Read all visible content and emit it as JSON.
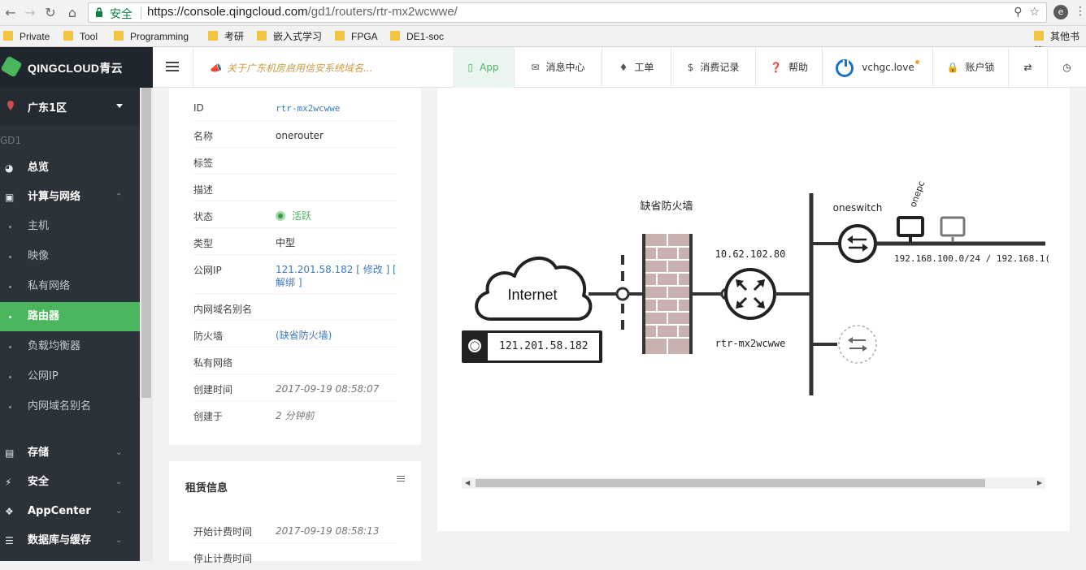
{
  "browser": {
    "secure_label": "安全",
    "url_host": "https://console.qingcloud.com",
    "url_path": "/gd1/routers/rtr-mx2wcwwe/",
    "bookmarks": [
      "Private",
      "Tool",
      "Programming",
      "考研",
      "嵌入式学习",
      "FPGA",
      "DE1-soc"
    ],
    "other_bookmarks": "其他书签"
  },
  "header": {
    "logo": "QINGCLOUD青云",
    "notice": "关于广东机房启用信安系统域名...",
    "nav": [
      {
        "icon": "phone-icon",
        "label": "App"
      },
      {
        "icon": "mail-icon",
        "label": "消息中心"
      },
      {
        "icon": "ticket-icon",
        "label": "工单"
      },
      {
        "icon": "dollar-icon",
        "label": "消费记录"
      },
      {
        "icon": "help-icon",
        "label": "帮助"
      },
      {
        "icon": "user-icon",
        "label": "vchgc.love"
      },
      {
        "icon": "lock-icon",
        "label": "账户锁"
      }
    ]
  },
  "sidebar": {
    "region": "广东1区",
    "zone": "GD1",
    "items": [
      {
        "icon": "dashboard-icon",
        "label": "总览",
        "type": "top"
      },
      {
        "icon": "monitor-icon",
        "label": "计算与网络",
        "type": "group-open"
      },
      {
        "label": "主机",
        "type": "sub"
      },
      {
        "label": "映像",
        "type": "sub"
      },
      {
        "label": "私有网络",
        "type": "sub"
      },
      {
        "label": "路由器",
        "type": "sub-active"
      },
      {
        "label": "负载均衡器",
        "type": "sub"
      },
      {
        "label": "公网IP",
        "type": "sub"
      },
      {
        "label": "内网域名别名",
        "type": "sub"
      },
      {
        "icon": "storage-icon",
        "label": "存储",
        "type": "group"
      },
      {
        "icon": "bolt-icon",
        "label": "安全",
        "type": "group"
      },
      {
        "icon": "puzzle-icon",
        "label": "AppCenter",
        "type": "group"
      },
      {
        "icon": "database-icon",
        "label": "数据库与缓存",
        "type": "group"
      }
    ]
  },
  "details": {
    "rows": [
      {
        "key": "ID",
        "value": "rtr-mx2wcwwe",
        "style": "mono"
      },
      {
        "key": "名称",
        "value": "onerouter",
        "style": "plain"
      },
      {
        "key": "标签",
        "value": "",
        "style": "plain"
      },
      {
        "key": "描述",
        "value": "",
        "style": "plain"
      },
      {
        "key": "状态",
        "value": "活跃",
        "style": "status"
      },
      {
        "key": "类型",
        "value": "中型",
        "style": "plain"
      },
      {
        "key": "公网IP",
        "value": "121.201.58.182 [ 修改 ] [ 解绑 ]",
        "style": "link"
      },
      {
        "key": "内网域名别名",
        "value": "",
        "style": "plain"
      },
      {
        "key": "防火墙",
        "value": "(缺省防火墙)",
        "style": "link"
      },
      {
        "key": "私有网络",
        "value": "",
        "style": "plain"
      },
      {
        "key": "创建时间",
        "value": "2017-09-19 08:58:07",
        "style": "ital"
      },
      {
        "key": "创建于",
        "value": "2 分钟前",
        "style": "ital"
      }
    ]
  },
  "lease": {
    "title": "租赁信息",
    "rows": [
      {
        "key": "开始计费时间",
        "value": "2017-09-19 08:58:13"
      },
      {
        "key": "停止计费时间",
        "value": ""
      }
    ]
  },
  "topology": {
    "internet_label": "Internet",
    "public_ip": "121.201.58.182",
    "firewall_label": "缺省防火墙",
    "router_ip": "10.62.102.80",
    "router_id": "rtr-mx2wcwwe",
    "switch_label": "oneswitch",
    "host_label": "onepc",
    "subnet_label": "192.168.100.0/24 / 192.168.1("
  }
}
